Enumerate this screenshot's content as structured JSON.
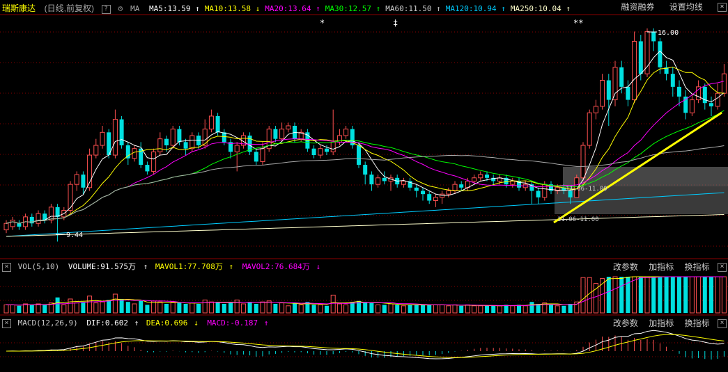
{
  "header": {
    "stock_name": "瑞斯康达",
    "mode": "(日线,前复权)",
    "ma_label": "MA",
    "ma": [
      {
        "label": "MA5:13.59",
        "arrow": "↑",
        "color": "#ffffff"
      },
      {
        "label": "MA10:13.58",
        "arrow": "↓",
        "color": "#ffff00"
      },
      {
        "label": "MA20:13.64",
        "arrow": "↑",
        "color": "#ff00ff"
      },
      {
        "label": "MA30:12.57",
        "arrow": "↑",
        "color": "#00ff00"
      },
      {
        "label": "MA60:11.50",
        "arrow": "↑",
        "color": "#cccccc"
      },
      {
        "label": "MA120:10.94",
        "arrow": "↑",
        "color": "#00ccff"
      },
      {
        "label": "MA250:10.04",
        "arrow": "↑",
        "color": "#ffffcc"
      }
    ],
    "right_links": [
      "融资融券",
      "设置均线"
    ]
  },
  "price_chart": {
    "high_label": "16.00",
    "low_label": "9.44",
    "range_label_1": "11.06-11.00",
    "range_label_2": "11.06-11.00",
    "markers": [
      "*",
      "‡",
      "**"
    ]
  },
  "volume_panel": {
    "label": "VOL(5,10)",
    "volume": "VOLUME:91.575万",
    "mavol1": "MAVOL1:77.708万",
    "mavol1_arrow": "↑",
    "mavol2": "MAVOL2:76.684万",
    "mavol2_arrow": "↓",
    "links": [
      "改参数",
      "加指标",
      "换指标"
    ]
  },
  "macd_panel": {
    "label": "MACD(12,26,9)",
    "dif": "DIF:0.602",
    "dif_arrow": "↑",
    "dea": "DEA:0.696",
    "dea_arrow": "↓",
    "macd": "MACD:-0.187",
    "macd_arrow": "↑",
    "links": [
      "改参数",
      "加指标",
      "换指标"
    ]
  },
  "colors": {
    "up": "#ff5050",
    "down": "#00e0e0",
    "dif": "#ffffff",
    "dea": "#ffff00",
    "grid": "#8b0000"
  },
  "chart_data": {
    "type": "candlestick",
    "ylim": [
      9.0,
      16.4
    ],
    "candles": [
      [
        9.8,
        10.0,
        10.1,
        9.7
      ],
      [
        9.9,
        10.1,
        10.2,
        9.8
      ],
      [
        10.0,
        9.9,
        10.1,
        9.8
      ],
      [
        9.9,
        10.2,
        10.3,
        9.8
      ],
      [
        10.2,
        10.0,
        10.3,
        9.9
      ],
      [
        10.0,
        10.3,
        10.4,
        9.9
      ],
      [
        10.3,
        10.1,
        10.4,
        10.0
      ],
      [
        10.1,
        10.5,
        10.6,
        10.0
      ],
      [
        10.5,
        10.2,
        10.6,
        9.44
      ],
      [
        10.2,
        10.4,
        10.5,
        10.1
      ],
      [
        10.4,
        11.2,
        11.3,
        10.3
      ],
      [
        11.2,
        11.5,
        11.6,
        11.0
      ],
      [
        11.5,
        11.1,
        11.6,
        10.9
      ],
      [
        11.1,
        12.1,
        12.3,
        11.0
      ],
      [
        12.1,
        12.4,
        12.6,
        12.0
      ],
      [
        12.4,
        12.8,
        13.0,
        12.3
      ],
      [
        12.8,
        12.1,
        12.9,
        12.0
      ],
      [
        12.1,
        13.2,
        13.5,
        12.0
      ],
      [
        13.2,
        12.4,
        13.3,
        12.3
      ],
      [
        12.4,
        12.0,
        12.5,
        11.8
      ],
      [
        12.0,
        12.3,
        12.4,
        11.9
      ],
      [
        12.3,
        11.8,
        12.5,
        11.7
      ],
      [
        11.8,
        11.6,
        11.9,
        11.5
      ],
      [
        11.6,
        12.2,
        12.3,
        11.5
      ],
      [
        12.2,
        12.6,
        12.8,
        12.1
      ],
      [
        12.6,
        12.4,
        12.7,
        12.2
      ],
      [
        12.4,
        12.9,
        13.0,
        12.3
      ],
      [
        12.9,
        12.5,
        13.0,
        12.4
      ],
      [
        12.5,
        12.3,
        12.6,
        12.1
      ],
      [
        12.3,
        12.7,
        12.8,
        12.2
      ],
      [
        12.7,
        12.4,
        12.8,
        12.3
      ],
      [
        12.4,
        12.9,
        13.2,
        12.3
      ],
      [
        12.9,
        13.3,
        13.5,
        12.8
      ],
      [
        13.3,
        12.8,
        13.4,
        12.7
      ],
      [
        12.8,
        12.5,
        12.9,
        12.4
      ],
      [
        12.5,
        12.2,
        12.6,
        12.0
      ],
      [
        12.2,
        12.4,
        12.5,
        11.6
      ],
      [
        12.4,
        12.7,
        12.8,
        12.3
      ],
      [
        12.7,
        12.2,
        12.8,
        12.1
      ],
      [
        12.2,
        11.9,
        12.3,
        11.8
      ],
      [
        11.9,
        12.3,
        12.5,
        11.8
      ],
      [
        12.3,
        12.9,
        13.0,
        12.2
      ],
      [
        12.9,
        12.6,
        13.0,
        12.5
      ],
      [
        12.6,
        12.9,
        13.1,
        12.5
      ],
      [
        12.9,
        13.0,
        13.1,
        12.8
      ],
      [
        13.0,
        12.6,
        13.1,
        12.5
      ],
      [
        12.6,
        12.8,
        12.9,
        12.5
      ],
      [
        12.8,
        12.3,
        12.9,
        12.2
      ],
      [
        12.3,
        12.1,
        12.4,
        12.0
      ],
      [
        12.1,
        12.3,
        12.4,
        12.0
      ],
      [
        12.3,
        12.2,
        12.4,
        12.1
      ],
      [
        12.2,
        12.5,
        13.5,
        12.1
      ],
      [
        12.5,
        12.7,
        12.9,
        12.4
      ],
      [
        12.7,
        12.9,
        13.0,
        12.6
      ],
      [
        12.9,
        12.4,
        13.0,
        12.3
      ],
      [
        12.4,
        11.8,
        12.5,
        11.7
      ],
      [
        11.8,
        11.5,
        11.9,
        11.2
      ],
      [
        11.5,
        11.2,
        11.6,
        11.0
      ],
      [
        11.2,
        11.4,
        11.5,
        11.1
      ],
      [
        11.4,
        11.3,
        11.6,
        11.2
      ],
      [
        11.3,
        11.4,
        11.5,
        11.0
      ],
      [
        11.4,
        11.2,
        11.5,
        11.1
      ],
      [
        11.2,
        11.3,
        11.4,
        11.1
      ],
      [
        11.3,
        11.1,
        11.4,
        11.0
      ],
      [
        11.1,
        11.0,
        11.2,
        10.8
      ],
      [
        11.0,
        10.9,
        11.1,
        10.7
      ],
      [
        10.9,
        10.7,
        11.0,
        10.6
      ],
      [
        10.7,
        10.8,
        10.9,
        10.5
      ],
      [
        10.8,
        10.9,
        11.0,
        10.6
      ],
      [
        10.9,
        11.0,
        11.1,
        10.8
      ],
      [
        11.0,
        11.2,
        11.3,
        10.9
      ],
      [
        11.2,
        11.1,
        11.3,
        11.0
      ],
      [
        11.1,
        11.3,
        11.4,
        11.0
      ],
      [
        11.3,
        11.4,
        11.5,
        11.2
      ],
      [
        11.4,
        11.5,
        11.6,
        11.3
      ],
      [
        11.5,
        11.4,
        11.6,
        11.3
      ],
      [
        11.4,
        11.3,
        11.5,
        11.2
      ],
      [
        11.3,
        11.4,
        11.5,
        11.2
      ],
      [
        11.4,
        11.2,
        11.5,
        11.1
      ],
      [
        11.2,
        11.3,
        11.4,
        11.1
      ],
      [
        11.3,
        11.1,
        11.4,
        11.0
      ],
      [
        11.1,
        11.2,
        11.3,
        11.0
      ],
      [
        11.2,
        11.0,
        11.3,
        10.6
      ],
      [
        11.0,
        10.8,
        11.1,
        10.6
      ],
      [
        10.8,
        11.2,
        11.3,
        10.7
      ],
      [
        11.2,
        11.0,
        11.3,
        10.9
      ],
      [
        11.0,
        11.1,
        11.2,
        10.9
      ],
      [
        11.1,
        11.0,
        11.2,
        10.9
      ],
      [
        11.0,
        10.8,
        11.1,
        10.6
      ],
      [
        10.8,
        11.4,
        11.5,
        10.8
      ],
      [
        11.4,
        12.4,
        12.5,
        11.3
      ],
      [
        12.4,
        13.4,
        13.5,
        12.3
      ],
      [
        13.4,
        13.6,
        13.8,
        13.2
      ],
      [
        13.6,
        14.4,
        14.6,
        13.5
      ],
      [
        14.4,
        13.8,
        14.6,
        13.0
      ],
      [
        13.8,
        14.8,
        15.0,
        13.6
      ],
      [
        14.8,
        14.2,
        15.0,
        14.0
      ],
      [
        14.2,
        13.8,
        14.4,
        13.6
      ],
      [
        13.8,
        15.6,
        15.9,
        13.7
      ],
      [
        15.6,
        14.6,
        15.8,
        14.4
      ],
      [
        14.6,
        15.9,
        16.0,
        14.5
      ],
      [
        15.9,
        15.6,
        16.0,
        15.3
      ],
      [
        15.6,
        14.8,
        15.7,
        14.6
      ],
      [
        14.8,
        14.6,
        15.0,
        14.4
      ],
      [
        14.6,
        14.2,
        14.8,
        13.9
      ],
      [
        14.2,
        13.9,
        14.4,
        13.6
      ],
      [
        13.9,
        13.4,
        14.1,
        13.2
      ],
      [
        13.4,
        13.8,
        14.0,
        13.3
      ],
      [
        13.8,
        14.2,
        14.4,
        13.7
      ],
      [
        14.2,
        13.7,
        14.3,
        13.5
      ],
      [
        13.7,
        13.6,
        13.9,
        13.3
      ],
      [
        13.6,
        14.0,
        14.3,
        13.5
      ],
      [
        14.0,
        14.6,
        14.9,
        13.9
      ]
    ]
  }
}
